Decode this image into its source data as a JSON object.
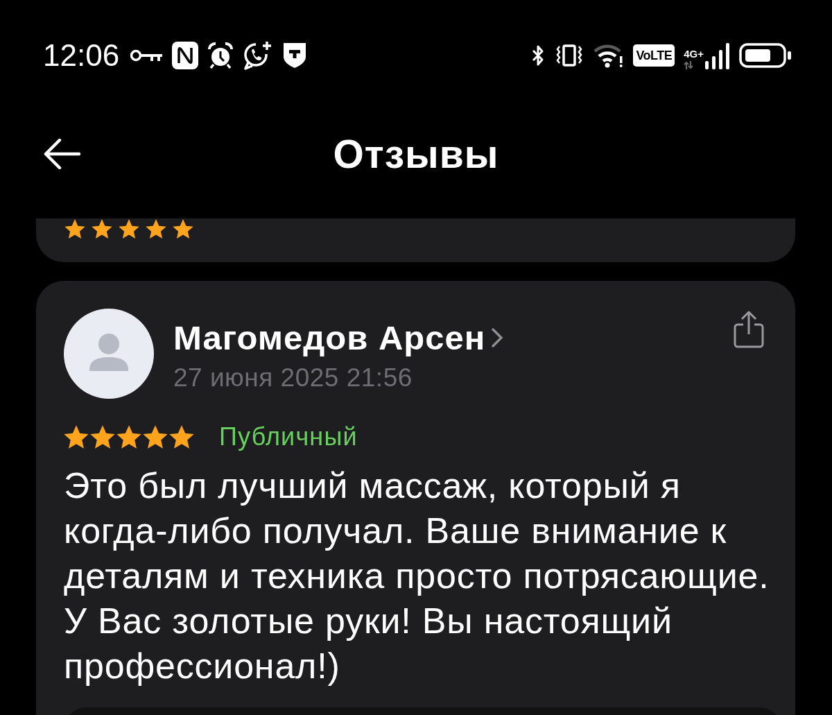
{
  "status_bar": {
    "time": "12:06",
    "network_badge": "VoLTE",
    "network_type": "4G+"
  },
  "header": {
    "title": "Отзывы"
  },
  "previous_review": {
    "stars": 5
  },
  "review": {
    "author": "Магомедов Арсен",
    "date": "27 июня 2025 21:56",
    "stars": 5,
    "visibility": "Публичный",
    "text": "Это был лучший массаж, который я когда-либо получал. Ваше внимание к деталям и техника просто потрясающие. У Вас золотые руки! Вы настоящий профессионал!)"
  }
}
